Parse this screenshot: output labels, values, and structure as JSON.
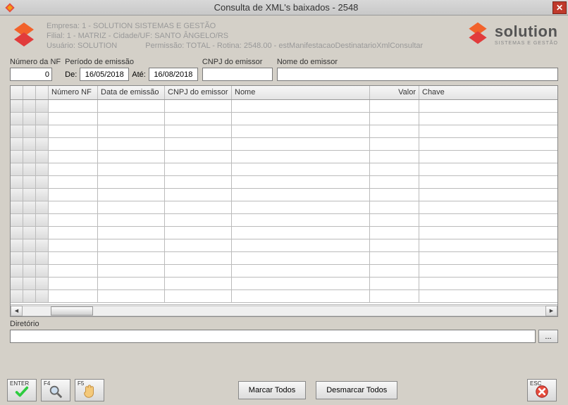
{
  "titlebar": {
    "title": "Consulta de XML's baixados - 2548"
  },
  "header": {
    "empresa": "Empresa: 1 - SOLUTION SISTEMAS E GESTÃO",
    "filial": "Filial: 1 - MATRIZ - Cidade/UF: SANTO ÂNGELO/RS",
    "usuario": "Usuário: SOLUTION",
    "permissao": "Permissão: TOTAL - Rotina: 2548.00 - estManifestacaoDestinatarioXmlConsultar",
    "brand_name": "solution",
    "brand_sub": "SISTEMAS E GESTÃO"
  },
  "filters": {
    "numero_nf_label": "Número da NF",
    "numero_nf_value": "0",
    "periodo_label": "Período de emissão",
    "de_label": "De:",
    "de_value": "16/05/2018",
    "ate_label": "Até:",
    "ate_value": "16/08/2018",
    "cnpj_label": "CNPJ do emissor",
    "cnpj_value": "",
    "nome_label": "Nome do emissor",
    "nome_value": ""
  },
  "grid": {
    "columns": {
      "numero": "Número NF",
      "data": "Data de emissão",
      "cnpj": "CNPJ do emissor",
      "nome": "Nome",
      "valor": "Valor",
      "chave": "Chave"
    },
    "row_count": 16
  },
  "directory": {
    "label": "Diretório",
    "value": "",
    "browse": "..."
  },
  "footer": {
    "enter": "ENTER",
    "f4": "F4",
    "f5": "F5",
    "marcar": "Marcar Todos",
    "desmarcar": "Desmarcar Todos",
    "esc": "ESC"
  }
}
